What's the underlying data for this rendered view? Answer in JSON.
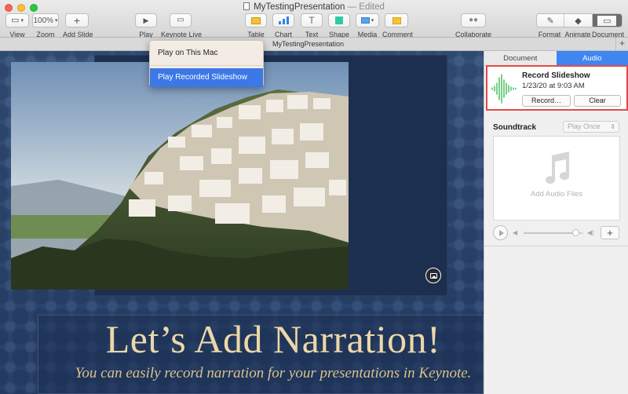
{
  "window": {
    "doc_name": "MyTestingPresentation",
    "status": "— Edited"
  },
  "toolbar": {
    "view_label": "View",
    "zoom_value": "100%",
    "zoom_label": "Zoom",
    "add_slide_label": "Add Slide",
    "play_label": "Play",
    "keynote_live_label": "Keynote Live",
    "table_label": "Table",
    "chart_label": "Chart",
    "text_label": "Text",
    "shape_label": "Shape",
    "media_label": "Media",
    "comment_label": "Comment",
    "collaborate_label": "Collaborate",
    "format_label": "Format",
    "animate_label": "Animate",
    "document_label": "Document"
  },
  "tabbar": {
    "title": "MyTestingPresentation",
    "add_symbol": "+"
  },
  "play_menu": {
    "items": [
      {
        "label": "Play on This Mac",
        "selected": false
      },
      {
        "label": "Play Recorded Slideshow",
        "selected": true
      }
    ]
  },
  "slide": {
    "title": "Let’s Add Narration!",
    "subtitle": "You can easily record narration for your presentations in Keynote."
  },
  "inspector": {
    "tabs": [
      {
        "label": "Document",
        "active": false
      },
      {
        "label": "Audio",
        "active": true
      }
    ],
    "record": {
      "title": "Record Slideshow",
      "date": "1/23/20 at 9:03 AM",
      "record_button": "Record…",
      "clear_button": "Clear"
    },
    "soundtrack": {
      "label": "Soundtrack",
      "mode": "Play Once",
      "drop_hint": "Add Audio Files",
      "volume": 0.92,
      "add_symbol": "+"
    }
  },
  "colors": {
    "accent": "#3c78e6",
    "inspector_tab_active": "#3f86f1",
    "highlight_border": "#e24b45",
    "slide_title": "#ecd7a8",
    "waveform": "#57c36a"
  }
}
